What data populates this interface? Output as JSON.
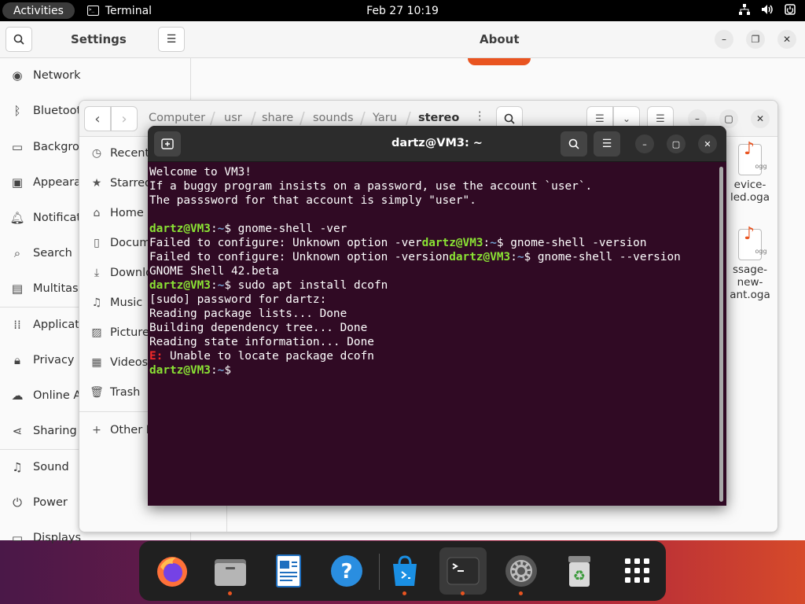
{
  "topbar": {
    "activities": "Activities",
    "app_name": "Terminal",
    "clock": "Feb 27  10:19"
  },
  "settings": {
    "title": "Settings",
    "panel_title": "About",
    "sidebar": [
      {
        "label": "Network",
        "icon": "network-icon"
      },
      {
        "label": "Bluetoot",
        "icon": "bluetooth-icon"
      },
      {
        "label": "Backgrou",
        "icon": "background-icon"
      },
      {
        "label": "Appeara",
        "icon": "appearance-icon"
      },
      {
        "label": "Notificat",
        "icon": "bell-icon"
      },
      {
        "label": "Search",
        "icon": "search-icon"
      },
      {
        "label": "Multitask",
        "icon": "multitasking-icon"
      },
      {
        "label": "Applicat",
        "icon": "grid-icon"
      },
      {
        "label": "Privacy",
        "icon": "lock-icon"
      },
      {
        "label": "Online Ac",
        "icon": "cloud-icon"
      },
      {
        "label": "Sharing",
        "icon": "share-icon"
      },
      {
        "label": "Sound",
        "icon": "music-note-icon"
      },
      {
        "label": "Power",
        "icon": "power-icon"
      },
      {
        "label": "Displays",
        "icon": "display-icon"
      }
    ]
  },
  "files": {
    "breadcrumb": [
      "Computer",
      "usr",
      "share",
      "sounds",
      "Yaru",
      "stereo"
    ],
    "sidebar": [
      {
        "label": "Recent",
        "icon": "clock-icon"
      },
      {
        "label": "Starred",
        "icon": "star-icon"
      },
      {
        "label": "Home",
        "icon": "home-icon"
      },
      {
        "label": "Docume",
        "icon": "document-icon"
      },
      {
        "label": "Downlo",
        "icon": "download-icon"
      },
      {
        "label": "Music",
        "icon": "music-icon"
      },
      {
        "label": "Picture",
        "icon": "picture-icon"
      },
      {
        "label": "Videos",
        "icon": "video-icon"
      },
      {
        "label": "Trash",
        "icon": "trash-icon"
      },
      {
        "label": "Other L",
        "icon": "plus-icon"
      }
    ],
    "tiles": [
      {
        "line1": "evice-",
        "line2": "led.oga",
        "line3": ""
      },
      {
        "line1": "ssage-",
        "line2": "new-",
        "line3": "ant.oga"
      }
    ],
    "ogg_label": "ogg"
  },
  "terminal": {
    "title": "dartz@VM3: ~",
    "prompt_user": "dartz@VM3",
    "prompt_path": "~",
    "lines": {
      "l1": "Welcome to VM3!",
      "l2": "If a buggy program insists on a password, use the account `user`.",
      "l3": "The passsword for that account is simply \"user\".",
      "c1": " gnome-shell -ver",
      "o1": "Failed to configure: Unknown option -ver",
      "c2": " gnome-shell -version",
      "o2": "Failed to configure: Unknown option -version",
      "c3": " gnome-shell --version",
      "o3": "GNOME Shell 42.beta",
      "c4": " sudo apt install dcofn",
      "o4": "[sudo] password for dartz:",
      "o5": "Reading package lists... Done",
      "o6": "Building dependency tree... Done",
      "o7": "Reading state information... Done",
      "err_tag": "E:",
      "err_msg": " Unable to locate package dcofn"
    }
  },
  "dock": {
    "apps": [
      "firefox-icon",
      "files-icon",
      "writer-icon",
      "help-icon",
      "software-icon",
      "terminal-icon",
      "settings-icon",
      "trash-icon",
      "app-grid-icon"
    ]
  },
  "colors": {
    "terminal_bg": "#300a24",
    "prompt_user": "#8ae234",
    "prompt_path": "#729fcf",
    "error": "#ef2929",
    "accent": "#e95420"
  }
}
